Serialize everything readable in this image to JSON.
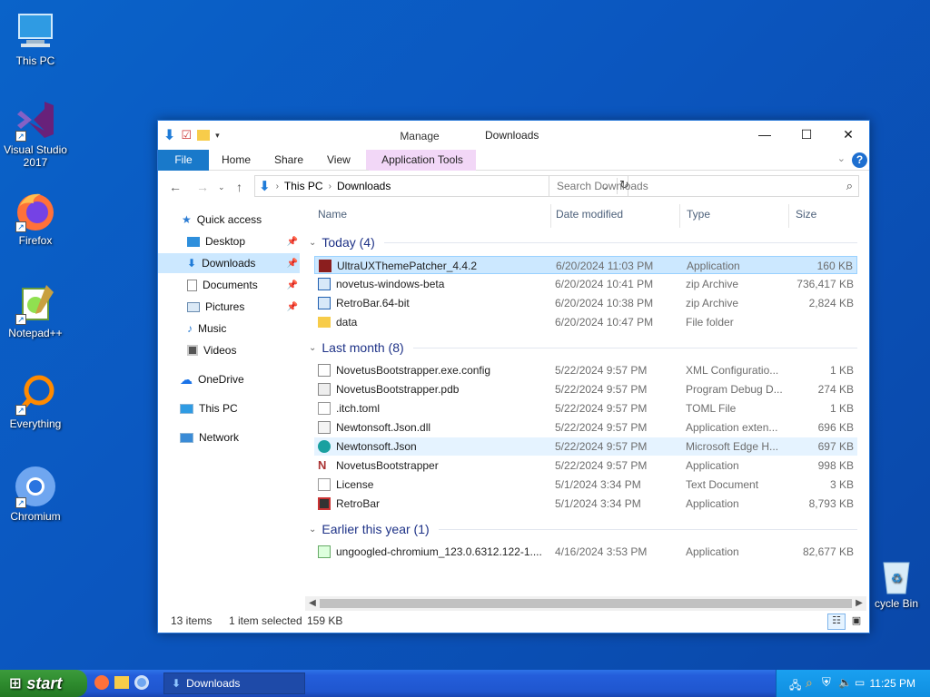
{
  "desktop": {
    "icons": [
      {
        "label": "This PC",
        "icon": "this-pc-icon"
      },
      {
        "label": "Visual Studio 2017",
        "icon": "visual-studio-icon"
      },
      {
        "label": "Firefox",
        "icon": "firefox-icon"
      },
      {
        "label": "Notepad++",
        "icon": "notepadpp-icon"
      },
      {
        "label": "Everything",
        "icon": "everything-icon"
      },
      {
        "label": "Chromium",
        "icon": "chromium-icon"
      },
      {
        "label": "cycle Bin",
        "icon": "recycle-bin-icon"
      }
    ]
  },
  "window": {
    "title": "Downloads",
    "manage_tab": "Manage",
    "ribbon_tabs": {
      "file": "File",
      "home": "Home",
      "share": "Share",
      "view": "View",
      "app_tools": "Application Tools"
    },
    "address": {
      "root": "This PC",
      "current": "Downloads"
    },
    "search_placeholder": "Search Downloads",
    "nav": {
      "quick_access": "Quick access",
      "desktop": "Desktop",
      "downloads": "Downloads",
      "documents": "Documents",
      "pictures": "Pictures",
      "music": "Music",
      "videos": "Videos",
      "onedrive": "OneDrive",
      "this_pc": "This PC",
      "network": "Network"
    },
    "columns": {
      "name": "Name",
      "date": "Date modified",
      "type": "Type",
      "size": "Size"
    },
    "groups": {
      "today": "Today (4)",
      "last_month": "Last month (8)",
      "earlier": "Earlier this year (1)"
    },
    "files": [
      {
        "name": "UltraUXThemePatcher_4.4.2",
        "date": "6/20/2024 11:03 PM",
        "type": "Application",
        "size": "160 KB"
      },
      {
        "name": "novetus-windows-beta",
        "date": "6/20/2024 10:41 PM",
        "type": "zip Archive",
        "size": "736,417 KB"
      },
      {
        "name": "RetroBar.64-bit",
        "date": "6/20/2024 10:38 PM",
        "type": "zip Archive",
        "size": "2,824 KB"
      },
      {
        "name": "data",
        "date": "6/20/2024 10:47 PM",
        "type": "File folder",
        "size": ""
      },
      {
        "name": "NovetusBootstrapper.exe.config",
        "date": "5/22/2024 9:57 PM",
        "type": "XML Configuratio...",
        "size": "1 KB"
      },
      {
        "name": "NovetusBootstrapper.pdb",
        "date": "5/22/2024 9:57 PM",
        "type": "Program Debug D...",
        "size": "274 KB"
      },
      {
        "name": ".itch.toml",
        "date": "5/22/2024 9:57 PM",
        "type": "TOML File",
        "size": "1 KB"
      },
      {
        "name": "Newtonsoft.Json.dll",
        "date": "5/22/2024 9:57 PM",
        "type": "Application exten...",
        "size": "696 KB"
      },
      {
        "name": "Newtonsoft.Json",
        "date": "5/22/2024 9:57 PM",
        "type": "Microsoft Edge H...",
        "size": "697 KB"
      },
      {
        "name": "NovetusBootstrapper",
        "date": "5/22/2024 9:57 PM",
        "type": "Application",
        "size": "998 KB"
      },
      {
        "name": "License",
        "date": "5/1/2024 3:34 PM",
        "type": "Text Document",
        "size": "3 KB"
      },
      {
        "name": "RetroBar",
        "date": "5/1/2024 3:34 PM",
        "type": "Application",
        "size": "8,793 KB"
      },
      {
        "name": "ungoogled-chromium_123.0.6312.122-1....",
        "date": "4/16/2024 3:53 PM",
        "type": "Application",
        "size": "82,677 KB"
      }
    ],
    "status": {
      "items": "13 items",
      "selected": "1 item selected",
      "size": "159 KB"
    }
  },
  "taskbar": {
    "start": "start",
    "task_button": "Downloads",
    "clock": "11:25 PM"
  },
  "colors": {
    "accent": "#1979ca",
    "selection": "#cce8ff",
    "group_text": "#1e3287"
  }
}
